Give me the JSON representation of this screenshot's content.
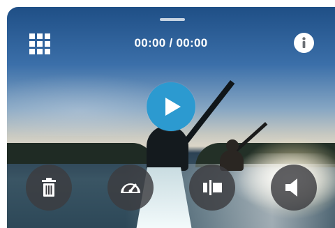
{
  "player": {
    "time_display": "00:00 / 00:00"
  },
  "icons": {
    "grid": "grid-icon",
    "info": "info-icon",
    "play": "play-icon",
    "delete": "trash-icon",
    "speed": "speedometer-icon",
    "trim": "trim-icon",
    "volume": "speaker-icon"
  },
  "colors": {
    "accent": "#2c9ad0",
    "control_bg": "#3c3c40",
    "icon": "#ffffff"
  }
}
